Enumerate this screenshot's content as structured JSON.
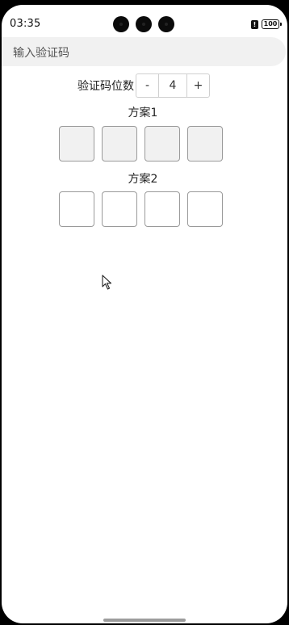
{
  "status_bar": {
    "time": "03:35",
    "battery": "100",
    "alert_glyph": "!"
  },
  "header": {
    "title": "输入验证码"
  },
  "digits": {
    "label": "验证码位数",
    "decrement": "-",
    "value": "4",
    "increment": "+"
  },
  "plans": [
    {
      "label": "方案1",
      "boxes": 4,
      "fill": "#f1f1f1"
    },
    {
      "label": "方案2",
      "boxes": 4,
      "fill": "#ffffff"
    }
  ],
  "icons": {
    "alert": "alert-icon",
    "battery": "battery-icon",
    "cursor": "mouse-pointer-icon"
  }
}
